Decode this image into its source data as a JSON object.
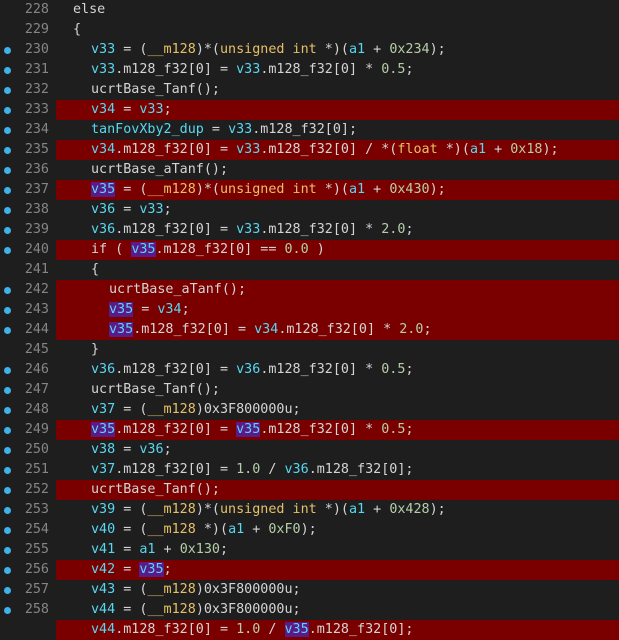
{
  "colors": {
    "background": "#1e1e1e",
    "highlight_line": "#7a0000",
    "breakpoint_dot": "#3fb3e8",
    "line_number": "#858585",
    "variable": "#57d8f2",
    "keyword_type": "#e6c068",
    "number_literal": "#b5cea8",
    "selected_token": "#5a1a8a"
  },
  "lines": [
    {
      "num": "228",
      "dot": false,
      "hl": false,
      "indent": 0,
      "tokens": [
        [
          "op",
          "else"
        ]
      ]
    },
    {
      "num": "229",
      "dot": false,
      "hl": false,
      "indent": 0,
      "tokens": [
        [
          "op",
          "{"
        ]
      ]
    },
    {
      "num": "230",
      "dot": true,
      "hl": false,
      "indent": 1,
      "tokens": [
        [
          "var",
          "v33"
        ],
        [
          "op",
          " = ("
        ],
        [
          "kw",
          "__m128"
        ],
        [
          "op",
          ")*("
        ],
        [
          "kw",
          "unsigned int"
        ],
        [
          "op",
          " *)("
        ],
        [
          "var",
          "a1"
        ],
        [
          "op",
          " + "
        ],
        [
          "num",
          "0x234"
        ],
        [
          "op",
          ");"
        ]
      ]
    },
    {
      "num": "231",
      "dot": true,
      "hl": false,
      "indent": 1,
      "tokens": [
        [
          "var",
          "v33"
        ],
        [
          "op",
          ".m128_f32[0] = "
        ],
        [
          "var",
          "v33"
        ],
        [
          "op",
          ".m128_f32[0] * "
        ],
        [
          "num",
          "0.5"
        ],
        [
          "op",
          ";"
        ]
      ]
    },
    {
      "num": "232",
      "dot": true,
      "hl": false,
      "indent": 1,
      "tokens": [
        [
          "op",
          "ucrtBase_Tanf();"
        ]
      ]
    },
    {
      "num": "233",
      "dot": true,
      "hl": true,
      "indent": 1,
      "tokens": [
        [
          "var",
          "v34"
        ],
        [
          "op",
          " = "
        ],
        [
          "var",
          "v33"
        ],
        [
          "op",
          ";"
        ]
      ]
    },
    {
      "num": "234",
      "dot": true,
      "hl": false,
      "indent": 1,
      "tokens": [
        [
          "var",
          "tanFovXby2_dup"
        ],
        [
          "op",
          " = "
        ],
        [
          "var",
          "v33"
        ],
        [
          "op",
          ".m128_f32[0];"
        ]
      ]
    },
    {
      "num": "235",
      "dot": true,
      "hl": true,
      "indent": 1,
      "tokens": [
        [
          "var",
          "v34"
        ],
        [
          "op",
          ".m128_f32[0] = "
        ],
        [
          "var",
          "v33"
        ],
        [
          "op",
          ".m128_f32[0] / *("
        ],
        [
          "kw",
          "float"
        ],
        [
          "op",
          " *)("
        ],
        [
          "var",
          "a1"
        ],
        [
          "op",
          " + "
        ],
        [
          "num",
          "0x18"
        ],
        [
          "op",
          ");"
        ]
      ]
    },
    {
      "num": "236",
      "dot": true,
      "hl": false,
      "indent": 1,
      "tokens": [
        [
          "op",
          "ucrtBase_aTanf();"
        ]
      ]
    },
    {
      "num": "237",
      "dot": true,
      "hl": true,
      "indent": 1,
      "tokens": [
        [
          "hi",
          "v35"
        ],
        [
          "op",
          " = ("
        ],
        [
          "kw",
          "__m128"
        ],
        [
          "op",
          ")*("
        ],
        [
          "kw",
          "unsigned int"
        ],
        [
          "op",
          " *)("
        ],
        [
          "var",
          "a1"
        ],
        [
          "op",
          " + "
        ],
        [
          "num",
          "0x430"
        ],
        [
          "op",
          ");"
        ]
      ]
    },
    {
      "num": "238",
      "dot": true,
      "hl": false,
      "indent": 1,
      "tokens": [
        [
          "var",
          "v36"
        ],
        [
          "op",
          " = "
        ],
        [
          "var",
          "v33"
        ],
        [
          "op",
          ";"
        ]
      ]
    },
    {
      "num": "239",
      "dot": true,
      "hl": false,
      "indent": 1,
      "tokens": [
        [
          "var",
          "v36"
        ],
        [
          "op",
          ".m128_f32[0] = "
        ],
        [
          "var",
          "v33"
        ],
        [
          "op",
          ".m128_f32[0] * "
        ],
        [
          "num",
          "2.0"
        ],
        [
          "op",
          ";"
        ]
      ]
    },
    {
      "num": "240",
      "dot": true,
      "hl": true,
      "indent": 1,
      "tokens": [
        [
          "op",
          "if ( "
        ],
        [
          "hi",
          "v35"
        ],
        [
          "op",
          ".m128_f32[0] == "
        ],
        [
          "num",
          "0.0"
        ],
        [
          "op",
          " )"
        ]
      ]
    },
    {
      "num": "241",
      "dot": false,
      "hl": false,
      "indent": 1,
      "tokens": [
        [
          "op",
          "{"
        ]
      ]
    },
    {
      "num": "242",
      "dot": true,
      "hl": true,
      "indent": 2,
      "tokens": [
        [
          "op",
          "ucrtBase_aTanf();"
        ]
      ]
    },
    {
      "num": "243",
      "dot": true,
      "hl": true,
      "indent": 2,
      "tokens": [
        [
          "hi",
          "v35"
        ],
        [
          "op",
          " = "
        ],
        [
          "var",
          "v34"
        ],
        [
          "op",
          ";"
        ]
      ]
    },
    {
      "num": "244",
      "dot": true,
      "hl": true,
      "indent": 2,
      "tokens": [
        [
          "hi",
          "v35"
        ],
        [
          "op",
          ".m128_f32[0] = "
        ],
        [
          "var",
          "v34"
        ],
        [
          "op",
          ".m128_f32[0] * "
        ],
        [
          "num",
          "2.0"
        ],
        [
          "op",
          ";"
        ]
      ]
    },
    {
      "num": "245",
      "dot": false,
      "hl": false,
      "indent": 1,
      "tokens": [
        [
          "op",
          "}"
        ]
      ]
    },
    {
      "num": "246",
      "dot": true,
      "hl": false,
      "indent": 1,
      "tokens": [
        [
          "var",
          "v36"
        ],
        [
          "op",
          ".m128_f32[0] = "
        ],
        [
          "var",
          "v36"
        ],
        [
          "op",
          ".m128_f32[0] * "
        ],
        [
          "num",
          "0.5"
        ],
        [
          "op",
          ";"
        ]
      ]
    },
    {
      "num": "247",
      "dot": true,
      "hl": false,
      "indent": 1,
      "tokens": [
        [
          "op",
          "ucrtBase_Tanf();"
        ]
      ]
    },
    {
      "num": "248",
      "dot": true,
      "hl": false,
      "indent": 1,
      "tokens": [
        [
          "var",
          "v37"
        ],
        [
          "op",
          " = ("
        ],
        [
          "kw",
          "__m128"
        ],
        [
          "op",
          ")0x3F800000u;"
        ]
      ]
    },
    {
      "num": "249",
      "dot": true,
      "hl": true,
      "indent": 1,
      "tokens": [
        [
          "hi",
          "v35"
        ],
        [
          "op",
          ".m128_f32[0] = "
        ],
        [
          "hi",
          "v35"
        ],
        [
          "op",
          ".m128_f32[0] * "
        ],
        [
          "num",
          "0.5"
        ],
        [
          "op",
          ";"
        ]
      ]
    },
    {
      "num": "250",
      "dot": true,
      "hl": false,
      "indent": 1,
      "tokens": [
        [
          "var",
          "v38"
        ],
        [
          "op",
          " = "
        ],
        [
          "var",
          "v36"
        ],
        [
          "op",
          ";"
        ]
      ]
    },
    {
      "num": "251",
      "dot": true,
      "hl": false,
      "indent": 1,
      "tokens": [
        [
          "var",
          "v37"
        ],
        [
          "op",
          ".m128_f32[0] = "
        ],
        [
          "num",
          "1.0"
        ],
        [
          "op",
          " / "
        ],
        [
          "var",
          "v36"
        ],
        [
          "op",
          ".m128_f32[0];"
        ]
      ]
    },
    {
      "num": "252",
      "dot": true,
      "hl": true,
      "indent": 1,
      "tokens": [
        [
          "op",
          "ucrtBase_Tanf();"
        ]
      ]
    },
    {
      "num": "253",
      "dot": true,
      "hl": false,
      "indent": 1,
      "tokens": [
        [
          "var",
          "v39"
        ],
        [
          "op",
          " = ("
        ],
        [
          "kw",
          "__m128"
        ],
        [
          "op",
          ")*("
        ],
        [
          "kw",
          "unsigned int"
        ],
        [
          "op",
          " *)("
        ],
        [
          "var",
          "a1"
        ],
        [
          "op",
          " + "
        ],
        [
          "num",
          "0x428"
        ],
        [
          "op",
          ");"
        ]
      ]
    },
    {
      "num": "254",
      "dot": true,
      "hl": false,
      "indent": 1,
      "tokens": [
        [
          "var",
          "v40"
        ],
        [
          "op",
          " = ("
        ],
        [
          "kw",
          "__m128"
        ],
        [
          "op",
          " *)("
        ],
        [
          "var",
          "a1"
        ],
        [
          "op",
          " + "
        ],
        [
          "num",
          "0xF0"
        ],
        [
          "op",
          ");"
        ]
      ]
    },
    {
      "num": "255",
      "dot": true,
      "hl": false,
      "indent": 1,
      "tokens": [
        [
          "var",
          "v41"
        ],
        [
          "op",
          " = "
        ],
        [
          "var",
          "a1"
        ],
        [
          "op",
          " + "
        ],
        [
          "num",
          "0x130"
        ],
        [
          "op",
          ";"
        ]
      ]
    },
    {
      "num": "256",
      "dot": true,
      "hl": true,
      "indent": 1,
      "tokens": [
        [
          "var",
          "v42"
        ],
        [
          "op",
          " = "
        ],
        [
          "hi",
          "v35"
        ],
        [
          "op",
          ";"
        ]
      ]
    },
    {
      "num": "257",
      "dot": true,
      "hl": false,
      "indent": 1,
      "tokens": [
        [
          "var",
          "v43"
        ],
        [
          "op",
          " = ("
        ],
        [
          "kw",
          "__m128"
        ],
        [
          "op",
          ")0x3F800000u;"
        ]
      ]
    },
    {
      "num": "258",
      "dot": true,
      "hl": false,
      "indent": 1,
      "tokens": [
        [
          "var",
          "v44"
        ],
        [
          "op",
          " = ("
        ],
        [
          "kw",
          "__m128"
        ],
        [
          "op",
          ")0x3F800000u;"
        ]
      ]
    },
    {
      "num": "",
      "dot": false,
      "hl": true,
      "indent": 1,
      "tokens": [
        [
          "var",
          "v44"
        ],
        [
          "op",
          ".m128_f32[0] = "
        ],
        [
          "num",
          "1.0"
        ],
        [
          "op",
          " / "
        ],
        [
          "hi",
          "v35"
        ],
        [
          "op",
          ".m128_f32[0];"
        ]
      ]
    }
  ]
}
